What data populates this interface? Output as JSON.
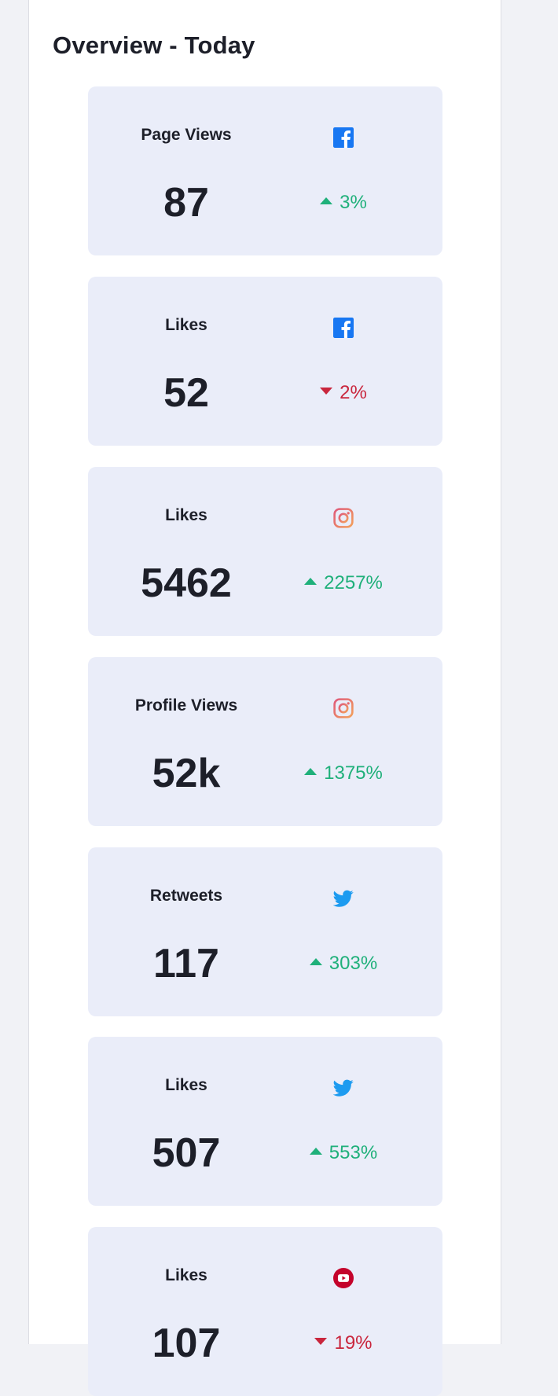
{
  "overview": {
    "title": "Overview - Today"
  },
  "colors": {
    "up": "#1fb07a",
    "down": "#c9263d",
    "card_bg": "#eaedf9",
    "facebook": "#1877f2",
    "twitter": "#1d9bf0",
    "youtube": "#c4032b"
  },
  "cards": [
    {
      "label": "Page Views",
      "icon": "facebook-icon",
      "value": "87",
      "change": "3%",
      "direction": "up"
    },
    {
      "label": "Likes",
      "icon": "facebook-icon",
      "value": "52",
      "change": "2%",
      "direction": "down"
    },
    {
      "label": "Likes",
      "icon": "instagram-icon",
      "value": "5462",
      "change": "2257%",
      "direction": "up"
    },
    {
      "label": "Profile Views",
      "icon": "instagram-icon",
      "value": "52k",
      "change": "1375%",
      "direction": "up"
    },
    {
      "label": "Retweets",
      "icon": "twitter-icon",
      "value": "117",
      "change": "303%",
      "direction": "up"
    },
    {
      "label": "Likes",
      "icon": "twitter-icon",
      "value": "507",
      "change": "553%",
      "direction": "up"
    },
    {
      "label": "Likes",
      "icon": "youtube-icon",
      "value": "107",
      "change": "19%",
      "direction": "down"
    }
  ]
}
